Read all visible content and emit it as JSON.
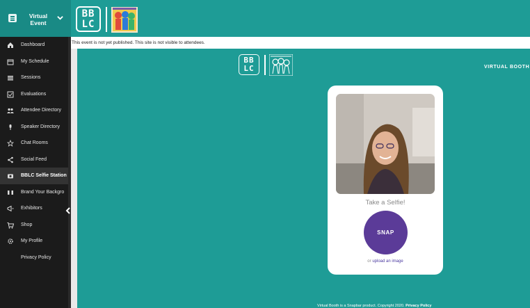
{
  "header": {
    "menu_title": "Virtual\nEvent",
    "logo_text": "BB\nLC"
  },
  "sidebar": {
    "items": [
      {
        "label": "Dashboard",
        "icon": "home-icon"
      },
      {
        "label": "My Schedule",
        "icon": "calendar-icon"
      },
      {
        "label": "Sessions",
        "icon": "list-icon"
      },
      {
        "label": "Evaluations",
        "icon": "checkbox-icon"
      },
      {
        "label": "Attendee Directory",
        "icon": "people-icon"
      },
      {
        "label": "Speaker Directory",
        "icon": "microphone-icon"
      },
      {
        "label": "Chat Rooms",
        "icon": "star-icon"
      },
      {
        "label": "Social Feed",
        "icon": "share-icon"
      },
      {
        "label": "BBLC Selfie Station",
        "icon": "camera-icon"
      },
      {
        "label": "Brand Your Backgro",
        "icon": "film-icon"
      },
      {
        "label": "Exhibitors",
        "icon": "megaphone-icon"
      },
      {
        "label": "Shop",
        "icon": "cart-icon"
      },
      {
        "label": "My Profile",
        "icon": "gear-icon"
      },
      {
        "label": "Privacy Policy",
        "icon": ""
      }
    ],
    "active_index": 8
  },
  "notice": "This event is not yet published. This site is not visible to attendees.",
  "main": {
    "logo_text": "BB\nLC",
    "virtual_booth": "VIRTUAL BOOTH",
    "take_selfie": "Take a Selfie!",
    "snap": "SNAP",
    "upload_prefix": "or",
    "upload_link": "upload an image",
    "footer_text": "Virtual Booth is a Snapbar product. Copyright 2020.",
    "footer_link": "Privacy Policy"
  },
  "colors": {
    "teal": "#1e9c96",
    "sidebar": "#1b1b1b",
    "snap_purple": "#5b3b98"
  }
}
